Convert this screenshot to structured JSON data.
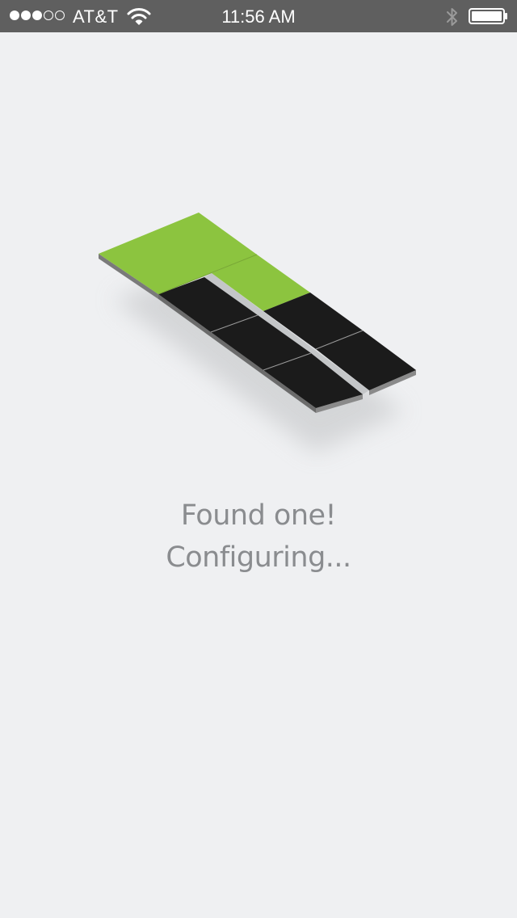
{
  "status_bar": {
    "carrier": "AT&T",
    "time": "11:56 AM",
    "signal_strength": 3,
    "signal_max": 5,
    "icons": [
      "wifi-icon",
      "bluetooth-icon",
      "battery-icon"
    ],
    "battery_level": 1.0
  },
  "main": {
    "illustration": "device-panels-icon",
    "line1": "Found one!",
    "line2": "Configuring..."
  },
  "colors": {
    "status_bar_bg": "#5f5f5f",
    "background": "#eff0f2",
    "accent_green": "#8cc43f",
    "panel_black": "#1b1b1b",
    "text_gray": "#8a8c8f"
  }
}
